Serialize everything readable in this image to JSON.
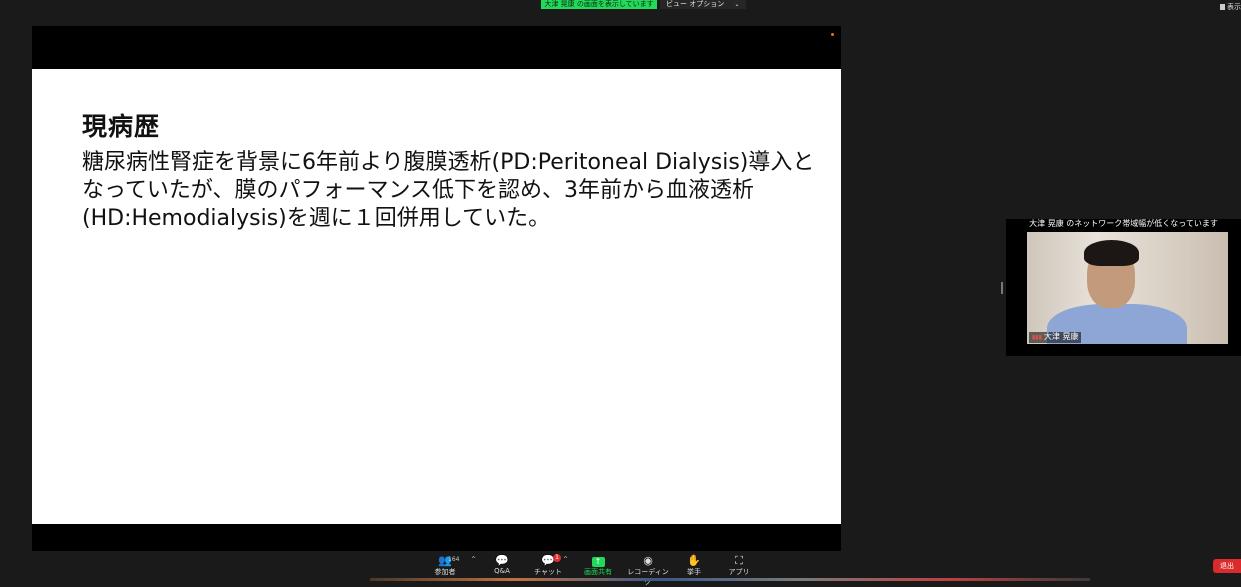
{
  "top": {
    "share_banner": "大津 晃康 の画面を表示しています",
    "view_options_label": "ビュー オプション",
    "view_options_caret": "⌄",
    "top_right_label": "表示"
  },
  "slide": {
    "title": "現病歴",
    "body": "糖尿病性腎症を背景に6年前より腹膜透析(PD:Peritoneal Dialysis)導入となっていたが、膜のパフォーマンス低下を認め、3年前から血液透析(HD:Hemodialysis)を週に１回併用していた。"
  },
  "video": {
    "network_warning": "大津 晃康 のネットワーク帯域幅が低くなっています",
    "participant_name": "大津 晃康"
  },
  "toolbar": {
    "participants_label": "参加者",
    "participants_count": "164",
    "qa_label": "Q&A",
    "chat_label": "チャット",
    "chat_badge": "1",
    "share_label": "画面共有",
    "recording_label": "レコーディング",
    "raise_hand_label": "挙手",
    "apps_label": "アプリ",
    "leave_label": "退出"
  },
  "colors": {
    "share_green": "#23d959",
    "leave_red": "#d92b2b",
    "background": "#1a1a1a"
  }
}
